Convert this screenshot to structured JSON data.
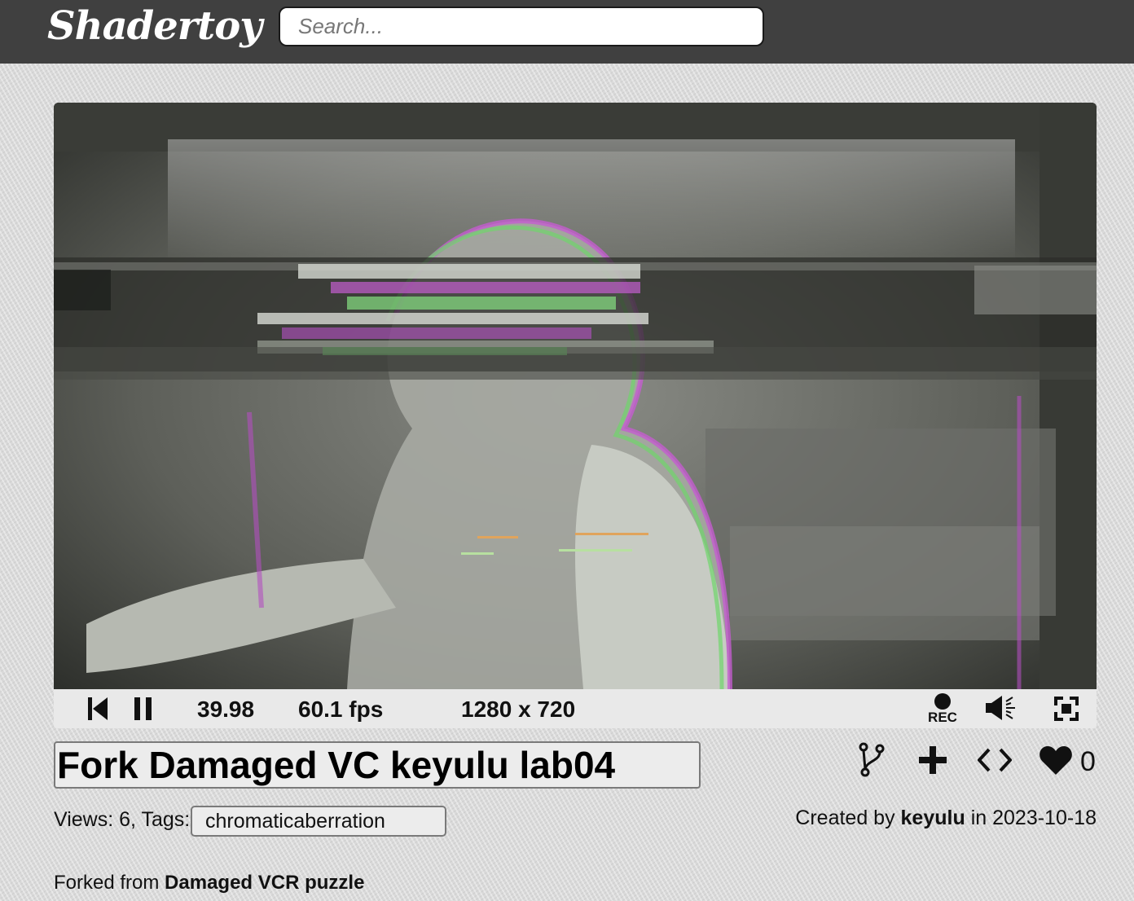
{
  "header": {
    "logo": "Shadertoy",
    "search_placeholder": "Search..."
  },
  "player": {
    "time": "39.98",
    "fps": "60.1 fps",
    "resolution": "1280 x 720",
    "rec_label": "REC",
    "icons": {
      "rewind": "skip-back-icon",
      "pause": "pause-icon",
      "record": "record-icon",
      "volume": "volume-icon",
      "fullscreen": "fullscreen-icon"
    }
  },
  "shader": {
    "title": "Fork Damaged VC keyulu lab04",
    "views_label": "Views: 6, Tags:",
    "tag": "chromaticaberration",
    "created_prefix": "Created by",
    "author": "keyulu",
    "created_in": "in",
    "date": "2023-10-18",
    "forked_prefix": "Forked from",
    "forked_name": "Damaged VCR puzzle",
    "likes": "0"
  },
  "actions": {
    "icons": [
      "fork-icon",
      "add-icon",
      "code-icon",
      "heart-icon"
    ]
  }
}
